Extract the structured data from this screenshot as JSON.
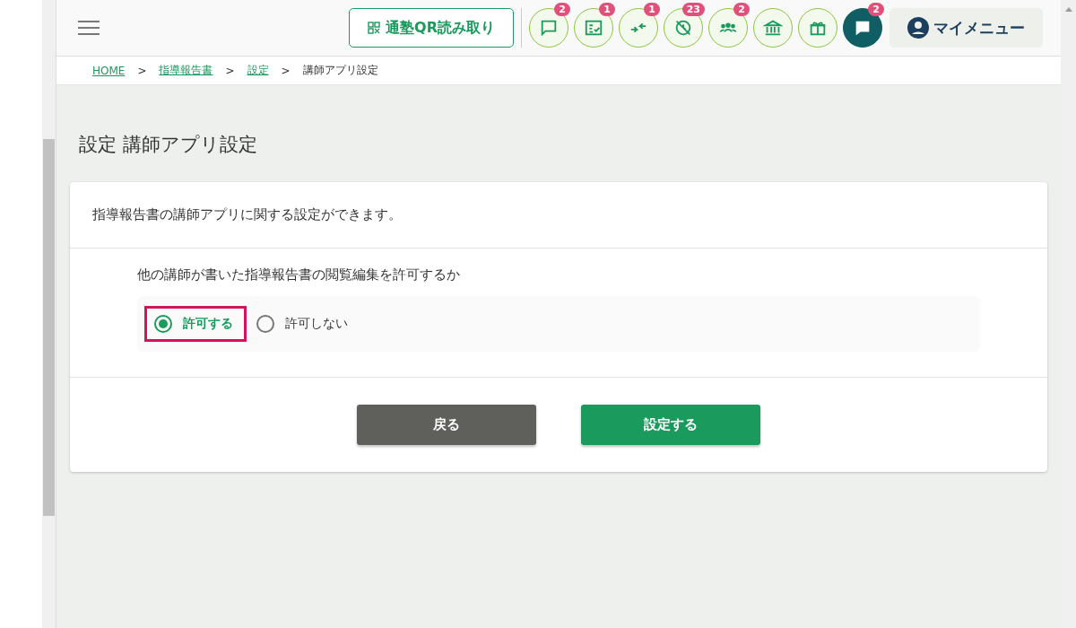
{
  "header": {
    "qr_button": "通塾QR読み取り",
    "icon_buttons": [
      {
        "kind": "chat",
        "badge": "2",
        "selected": false
      },
      {
        "kind": "checklist",
        "badge": "1",
        "selected": false
      },
      {
        "kind": "arrows",
        "badge": "1",
        "selected": false
      },
      {
        "kind": "clock-off",
        "badge": "23",
        "selected": false
      },
      {
        "kind": "people",
        "badge": "2",
        "selected": false
      },
      {
        "kind": "bank",
        "selected": false
      },
      {
        "kind": "gift",
        "selected": false
      },
      {
        "kind": "message",
        "badge": "2",
        "selected": true
      }
    ],
    "my_menu": "マイメニュー"
  },
  "breadcrumb": [
    {
      "label": "HOME",
      "link": true
    },
    {
      "label": "指導報告書",
      "link": true
    },
    {
      "label": "設定",
      "link": true
    },
    {
      "label": "講師アプリ設定",
      "link": false
    }
  ],
  "breadcrumb_separator": ">",
  "page_title": "設定 講師アプリ設定",
  "card": {
    "description": "指導報告書の講師アプリに関する設定ができます。",
    "question": "他の講師が書いた指導報告書の閲覧編集を許可するか",
    "options": [
      {
        "label": "許可する",
        "selected": true
      },
      {
        "label": "許可しない",
        "selected": false
      }
    ],
    "buttons": [
      {
        "kind": "back",
        "label": "戻る"
      },
      {
        "kind": "submit",
        "label": "設定する"
      }
    ]
  }
}
